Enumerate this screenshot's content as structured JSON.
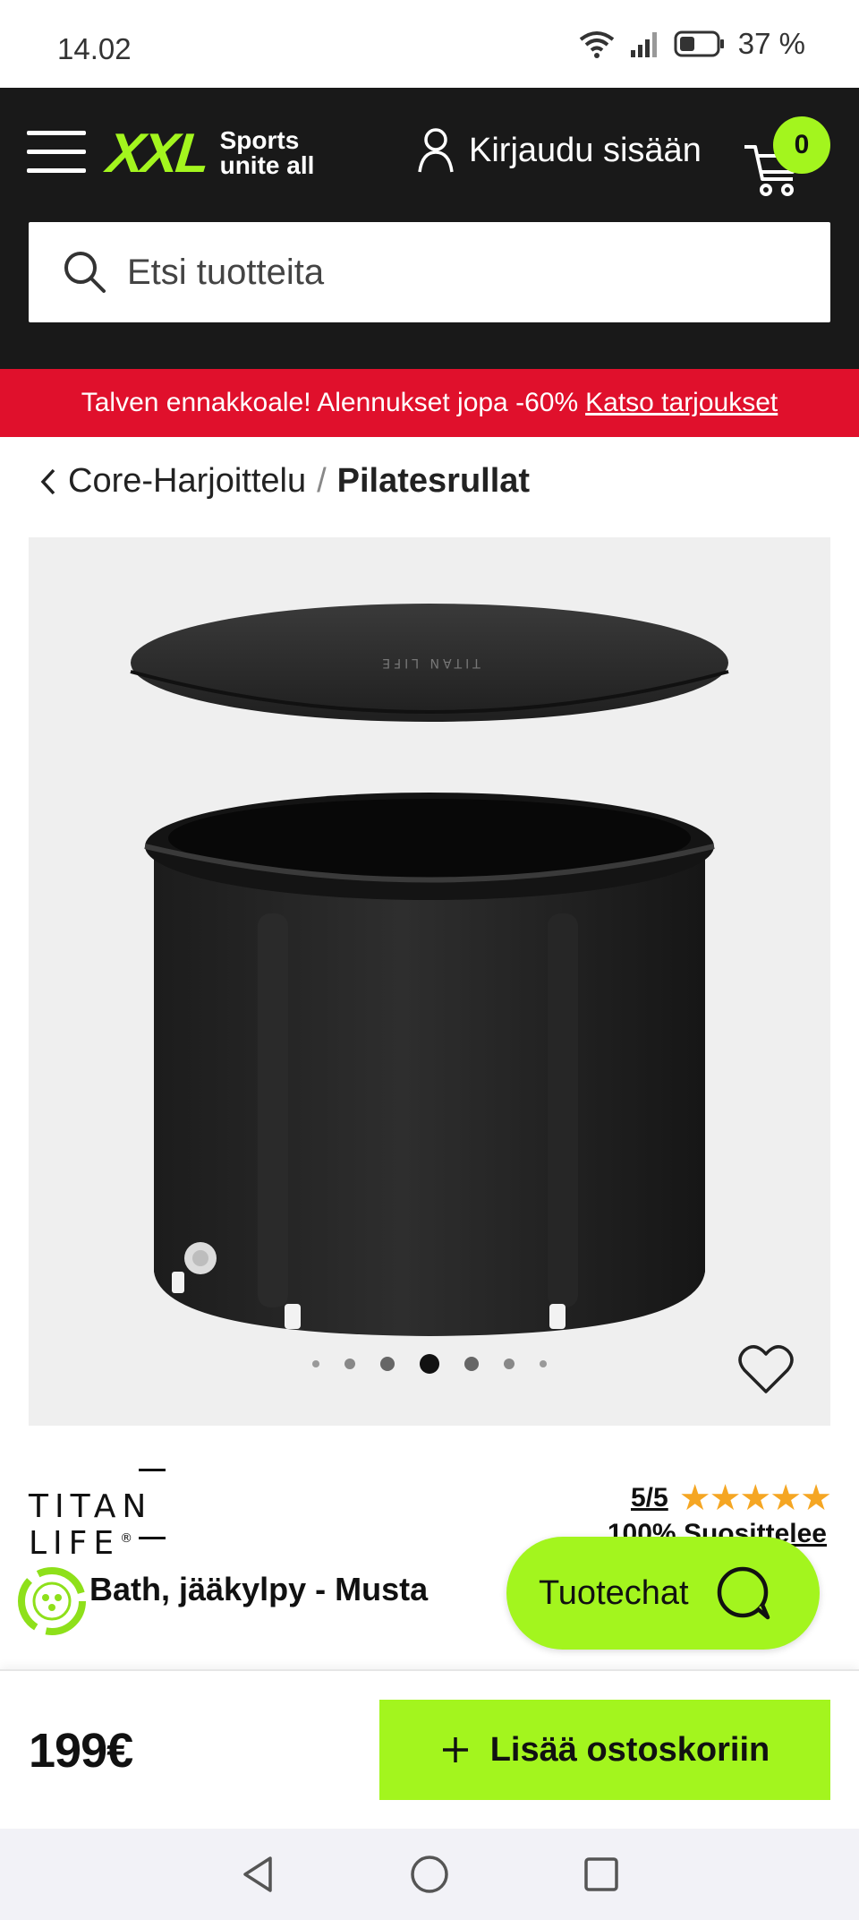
{
  "status_bar": {
    "time": "14.02",
    "battery": "37 %"
  },
  "header": {
    "logo_text": "XXL",
    "logo_tagline_1": "Sports",
    "logo_tagline_2": "unite all",
    "login_label": "Kirjaudu sisään",
    "cart_count": "0",
    "search_placeholder": "Etsi tuotteita"
  },
  "promo": {
    "text": "Talven ennakkoale! Alennukset jopa -60%",
    "link": "Katso tarjoukset"
  },
  "breadcrumb": {
    "parent": "Core-Harjoittelu",
    "separator": "/",
    "current": "Pilatesrullat"
  },
  "gallery": {
    "product_image_logo": "TITAN LIFE",
    "dot_count": 7,
    "active_dot": 3
  },
  "product": {
    "brand": "TITAN LIFE",
    "brand_mark": "®",
    "rating_score": "5/5",
    "stars": "★★★★★",
    "recommend": "100% Suosittelee",
    "title": "Bath, jääkylpy - Musta"
  },
  "chat": {
    "label": "Tuotechat"
  },
  "buybar": {
    "price": "199€",
    "add_to_cart": "Lisää ostoskoriin"
  },
  "colors": {
    "brand_green": "#a3f51e",
    "header_bg": "#191919",
    "promo_red": "#e0102c",
    "star": "#f5a623"
  }
}
